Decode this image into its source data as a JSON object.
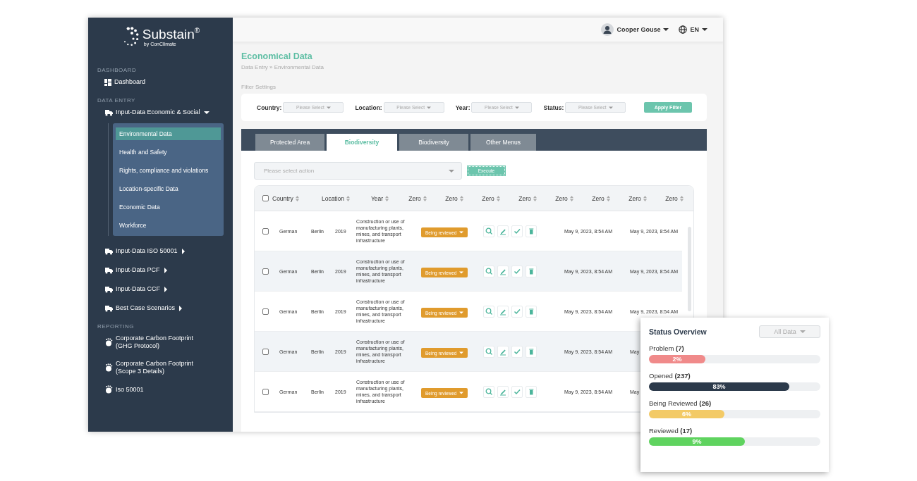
{
  "logo": {
    "name": "Substain",
    "mark": "®",
    "tagline": "by ConClimate"
  },
  "sidebar": {
    "sections": [
      {
        "heading": "DASHBOARD",
        "kind": "dashboard",
        "items": [
          {
            "label": "Dashboard"
          }
        ]
      },
      {
        "heading": "DATA ENTRY",
        "kind": "entry",
        "items": [
          {
            "label": "Input-Data Economic & Social",
            "expanded": true,
            "children": [
              {
                "label": "Environmental Data",
                "selected": true
              },
              {
                "label": "Health and Safety",
                "selected": false
              },
              {
                "label": "Rights, compliance and violations",
                "selected": false
              },
              {
                "label": "Location-specific Data",
                "selected": false
              },
              {
                "label": "Economic Data",
                "selected": false
              },
              {
                "label": "Workforce",
                "selected": false
              }
            ]
          },
          {
            "label": "Input-Data ISO 50001",
            "expanded": false
          },
          {
            "label": "Input-Data PCF",
            "expanded": false
          },
          {
            "label": "Input-Data CCF",
            "expanded": false
          },
          {
            "label": "Best Case Scenarios",
            "expanded": false
          }
        ]
      },
      {
        "heading": "REPORTING",
        "kind": "reporting",
        "items": [
          {
            "label": "Corporate Carbon Footprint (GHG Protocol)"
          },
          {
            "label": "Corporate Carbon Footprint (Scope 3 Details)"
          },
          {
            "label": "Iso 50001"
          }
        ]
      }
    ]
  },
  "header": {
    "user": "Cooper Gouse",
    "language": "EN"
  },
  "page": {
    "title": "Economical Data",
    "breadcrumb": "Data Entry » Environmental Data"
  },
  "filters": {
    "label": "Filter Settings",
    "fields": [
      {
        "label": "Country:",
        "placeholder": "Please Select"
      },
      {
        "label": "Location:",
        "placeholder": "Please Select"
      },
      {
        "label": "Year:",
        "placeholder": "Please Select"
      },
      {
        "label": "Status:",
        "placeholder": "Please Select"
      }
    ],
    "apply": "Apply Filter"
  },
  "tabs": [
    {
      "label": "Protected Area",
      "selected": false
    },
    {
      "label": "Biodiversity",
      "selected": true
    },
    {
      "label": "Biodiversity",
      "selected": false
    },
    {
      "label": "Other Menus",
      "selected": false
    }
  ],
  "action": {
    "placeholder": "Please select action",
    "execute": "Execute"
  },
  "table": {
    "all_checked": false,
    "columns": [
      "Country",
      "Location",
      "Year",
      "Zero",
      "Zero",
      "Zero",
      "Zero",
      "Zero",
      "Zero",
      "Zero",
      "Zero"
    ],
    "rows": [
      {
        "checked": false,
        "country": "German",
        "location": "Berlin",
        "year": "2019",
        "description": "Construction or use of manufacturing plants, mines, and transport infrastructure",
        "status": "Being reviewed",
        "date_1": "May 9, 2023, 8:54 AM",
        "date_2": "May 9, 2023, 8:54 AM"
      },
      {
        "checked": false,
        "country": "German",
        "location": "Berlin",
        "year": "2019",
        "description": "Construction or use of manufacturing plants, mines, and transport infrastructure",
        "status": "Being reviewed",
        "date_1": "May 9, 2023, 8:54 AM",
        "date_2": "May 9, 2023, 8:54 AM"
      },
      {
        "checked": false,
        "country": "German",
        "location": "Berlin",
        "year": "2019",
        "description": "Construction or use of manufacturing plants, mines, and transport infrastructure",
        "status": "Being reviewed",
        "date_1": "May 9, 2023, 8:54 AM",
        "date_2": "May 9, 2023, 8:54 AM"
      },
      {
        "checked": false,
        "country": "German",
        "location": "Berlin",
        "year": "2019",
        "description": "Construction or use of manufacturing plants, mines, and transport infrastructure",
        "status": "Being reviewed",
        "date_1": "May 9, 2023, 8:54 AM",
        "date_2": "May"
      },
      {
        "checked": false,
        "country": "German",
        "location": "Berlin",
        "year": "2019",
        "description": "Construction or use of manufacturing plants, mines, and transport infrastructure",
        "status": "Being reviewed",
        "date_1": "May 9, 2023, 8:54 AM",
        "date_2": "May"
      }
    ]
  },
  "status_overview": {
    "title": "Status Overview",
    "filter": "All Data",
    "items": [
      {
        "label": "Problem **(7)**",
        "percent": "2%",
        "level": 0.33,
        "color": "#f08a8a"
      },
      {
        "label": "Opened **(237)**",
        "percent": "83%",
        "level": 0.82,
        "color": "#2c3a4b"
      },
      {
        "label": "Being Reviewed **(26)**",
        "percent": "6%",
        "level": 0.44,
        "color": "#f3ca66"
      },
      {
        "label": "Reviewed **(17)**",
        "percent": "9%",
        "level": 0.56,
        "color": "#5fd35f"
      }
    ]
  }
}
